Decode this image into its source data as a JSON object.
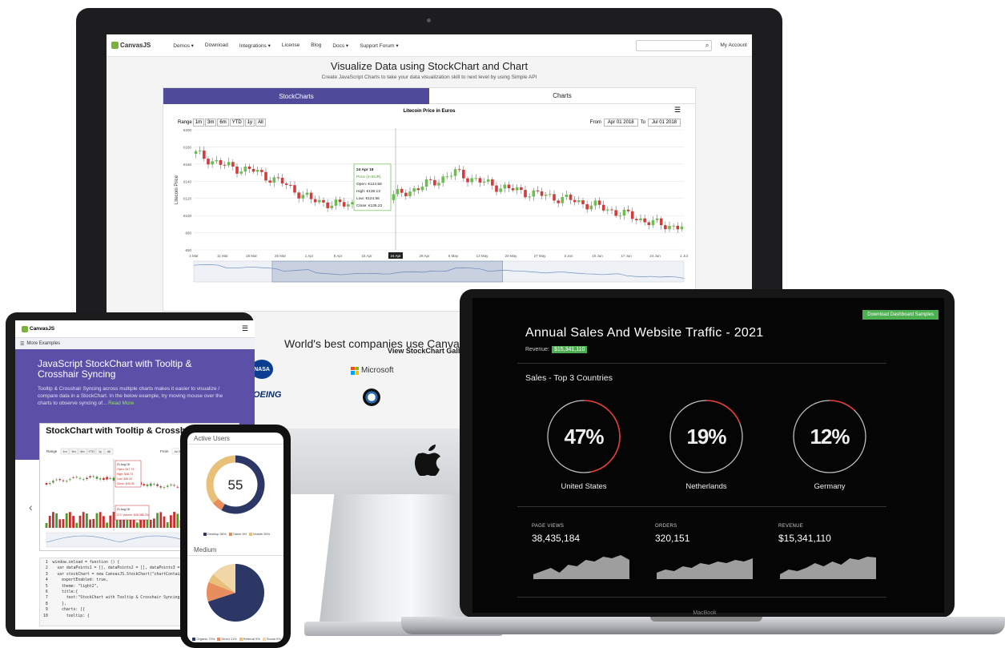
{
  "imac": {
    "nav": {
      "logo": "CanvasJS",
      "items": [
        "Demos ▾",
        "Download",
        "Integrations ▾",
        "License",
        "Blog",
        "Docs ▾",
        "Support Forum ▾"
      ],
      "account": "My Account"
    },
    "hero_title": "Visualize Data using StockChart and Chart",
    "hero_subtitle": "Create JavaScript Charts to take your data visualization skill to next level by using Simple API",
    "tabs": [
      "StockCharts",
      "Charts"
    ],
    "stockchart": {
      "title": "Litecoin Price in Euros",
      "range_label": "Range",
      "range_buttons": [
        "1m",
        "3m",
        "6m",
        "YTD",
        "1y",
        "All"
      ],
      "from_label": "From",
      "from_value": "Apr 01 2018",
      "to_label": "To",
      "to_value": "Jul 01 2018",
      "y_axis_label": "Litecoin Price",
      "y_ticks": [
        "€200",
        "€180",
        "€160",
        "€140",
        "€120",
        "€100",
        "€80",
        "€60"
      ],
      "x_ticks": [
        "4 Mar",
        "11 Mar",
        "18 Mar",
        "25 Mar",
        "1 Apr",
        "8 Apr",
        "15 Apr",
        "22 Apr",
        "29 Apr",
        "6 May",
        "13 May",
        "20 May",
        "27 May",
        "3 Jun",
        "10 Jun",
        "17 Jun",
        "24 Jun",
        "1 Jul"
      ],
      "crosshair_label": "24 Apr",
      "tooltip": {
        "date": "24 Apr 18",
        "series": "Price (in EUR)",
        "open": "Open: €124.56",
        "high": "High: €136.13",
        "low": "Low: €124.56",
        "close": "Close: €135.22"
      }
    },
    "view_gallery": "View StockChart Gallery",
    "companies_title": "World's best companies use CanvasJS",
    "brands": {
      "nasa": "NASA",
      "microsoft": "Microsoft",
      "boeing": "BOEING"
    }
  },
  "tablet": {
    "logo": "CanvasJS",
    "more_examples": "More Examples",
    "hero_title": "JavaScript StockChart with Tooltip & Crosshair Syncing",
    "hero_text": "Tooltip & Crosshair Syncing across multiple charts makes it easier to visualize / compare data in a StockChart. In the below example, try moving mouse over the charts to observe syncing of...",
    "read_more": "Read More",
    "card_title": "StockChart with Tooltip & Crosshair Syncing",
    "card_range": "Range",
    "card_range_buttons": [
      "1m",
      "3m",
      "6m",
      "YTD",
      "1y",
      "All"
    ],
    "card_from": "From",
    "card_from_value": "Jul 01 2018",
    "tooltip1": {
      "date": "21 Aug 18",
      "open": "Open: $47.73",
      "high": "High: $48.73",
      "low": "Low: $45.20",
      "close": "Close: $45.35"
    },
    "tooltip2": {
      "date": "21 Aug 18",
      "series": "LTC Volume:",
      "value": "$48,388,234"
    },
    "code_lines": [
      "window.onload = function () {",
      "  var dataPoints1 = [], dataPoints2 = [], dataPoints3 = [];",
      "  var stockChart = new CanvasJS.StockChart(\"chartContainer\",{",
      "    exportEnabled: true,",
      "    theme: \"light2\",",
      "    title:{",
      "      text:\"StockChart with Tooltip & Crosshair Syncing\"",
      "    },",
      "    charts: [{",
      "      tooltip: {"
    ]
  },
  "phone": {
    "active_users_title": "Active Users",
    "active_users_value": "55",
    "legend1": [
      "Desktop 55%",
      "Tablet 5%",
      "Mobile 35%"
    ],
    "medium_title": "Medium",
    "legend2": [
      "Organic 70%",
      "Direct 11%",
      "Referral 5%",
      "Social 9%"
    ],
    "colors": [
      "#2c3766",
      "#e8c07a",
      "#e88d5e",
      "#f1d7a8"
    ]
  },
  "laptop": {
    "download_button": "Download Dashboard Samples",
    "title": "Annual Sales And Website Traffic - 2021",
    "revenue_label": "Revenue:",
    "revenue_value": "$15,341,110",
    "sales_subtitle": "Sales - Top 3 Countries",
    "gauges": [
      {
        "value": "47%",
        "label": "United States",
        "fraction": 0.47
      },
      {
        "value": "19%",
        "label": "Netherlands",
        "fraction": 0.19
      },
      {
        "value": "12%",
        "label": "Germany",
        "fraction": 0.12
      }
    ],
    "kpis": [
      {
        "label": "PAGE VIEWS",
        "value": "38,435,184"
      },
      {
        "label": "ORDERS",
        "value": "320,151"
      },
      {
        "label": "REVENUE",
        "value": "$15,341,110"
      }
    ],
    "brand_label": "MacBook",
    "gauge_color": "#e53935",
    "accent": "#4caf50"
  },
  "chart_data": {
    "type": "candlestick",
    "title": "Litecoin Price in Euros",
    "ylabel": "Litecoin Price",
    "ylim": [
      60,
      200
    ],
    "x": [
      "4 Mar",
      "11 Mar",
      "18 Mar",
      "25 Mar",
      "1 Apr",
      "8 Apr",
      "15 Apr",
      "22 Apr",
      "29 Apr",
      "6 May",
      "13 May",
      "20 May",
      "27 May",
      "3 Jun",
      "10 Jun",
      "17 Jun",
      "24 Jun",
      "1 Jul"
    ],
    "close": [
      172,
      158,
      152,
      138,
      118,
      112,
      118,
      124,
      136,
      150,
      138,
      130,
      124,
      118,
      110,
      100,
      90,
      86
    ]
  }
}
